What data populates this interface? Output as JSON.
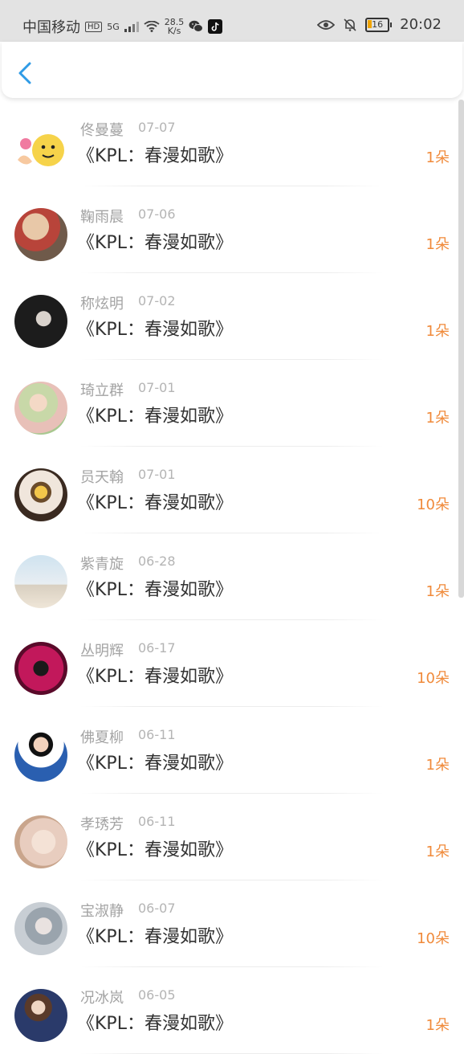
{
  "status_bar": {
    "carrier": "中国移动",
    "hd": "HD",
    "network": "5G",
    "speed_value": "28.5",
    "speed_unit": "K/s",
    "battery": "16",
    "time": "20:02"
  },
  "colors": {
    "accent_back": "#2f9be6",
    "amount_orange": "#f08a3a",
    "title_text": "#333333",
    "meta_text": "#a3a3a3"
  },
  "list": [
    {
      "name": "佟曼蔓",
      "date": "07-07",
      "title": "《KPL：春漫如歌》",
      "amount": "1朵"
    },
    {
      "name": "鞠雨晨",
      "date": "07-06",
      "title": "《KPL：春漫如歌》",
      "amount": "1朵"
    },
    {
      "name": "称炫明",
      "date": "07-02",
      "title": "《KPL：春漫如歌》",
      "amount": "1朵"
    },
    {
      "name": "琦立群",
      "date": "07-01",
      "title": "《KPL：春漫如歌》",
      "amount": "1朵"
    },
    {
      "name": "员天翰",
      "date": "07-01",
      "title": "《KPL：春漫如歌》",
      "amount": "10朵"
    },
    {
      "name": "紫青旋",
      "date": "06-28",
      "title": "《KPL：春漫如歌》",
      "amount": "1朵"
    },
    {
      "name": "丛明辉",
      "date": "06-17",
      "title": "《KPL：春漫如歌》",
      "amount": "10朵"
    },
    {
      "name": "佛夏柳",
      "date": "06-11",
      "title": "《KPL：春漫如歌》",
      "amount": "1朵"
    },
    {
      "name": "孝琇芳",
      "date": "06-11",
      "title": "《KPL：春漫如歌》",
      "amount": "1朵"
    },
    {
      "name": "宝淑静",
      "date": "06-07",
      "title": "《KPL：春漫如歌》",
      "amount": "10朵"
    },
    {
      "name": "况冰岚",
      "date": "06-05",
      "title": "《KPL：春漫如歌》",
      "amount": "1朵"
    }
  ]
}
